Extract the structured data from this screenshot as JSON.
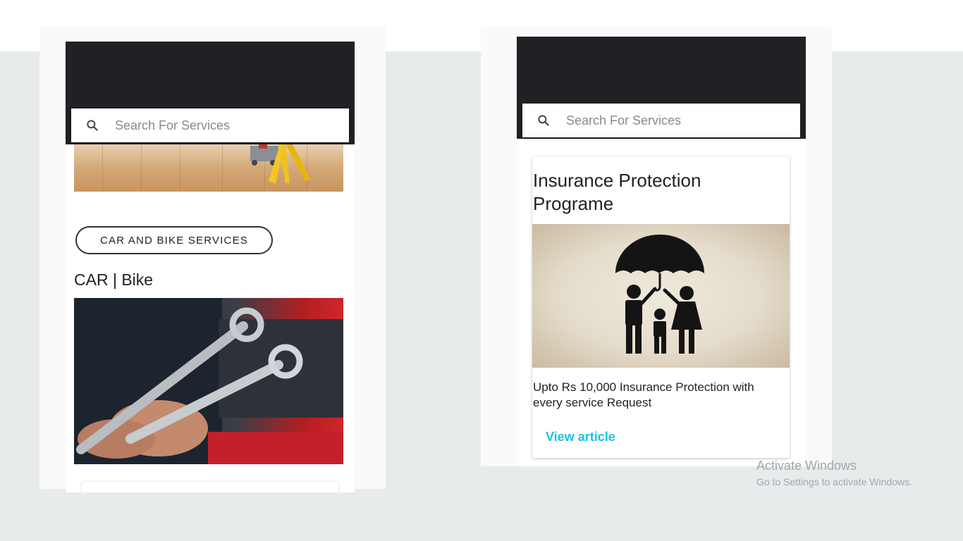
{
  "left_screen": {
    "search": {
      "placeholder": "Search For Services"
    },
    "category_chip": "CAR AND BIKE SERVICES",
    "section_title": "CAR | Bike"
  },
  "right_screen": {
    "search": {
      "placeholder": "Search For Services"
    },
    "card": {
      "title": "Insurance Protection Programe",
      "description": "Upto Rs 10,000 Insurance Protection with every service Request",
      "link_label": "View article"
    }
  },
  "watermark": {
    "title": "Activate Windows",
    "subtitle": "Go to Settings to activate Windows."
  },
  "colors": {
    "topbar": "#202124",
    "link": "#19c3e6",
    "background": "#e8ebec"
  },
  "icons": [
    "search-icon",
    "umbrella-family-illustration",
    "wrench-illustration",
    "wet-floor-sign-illustration"
  ]
}
